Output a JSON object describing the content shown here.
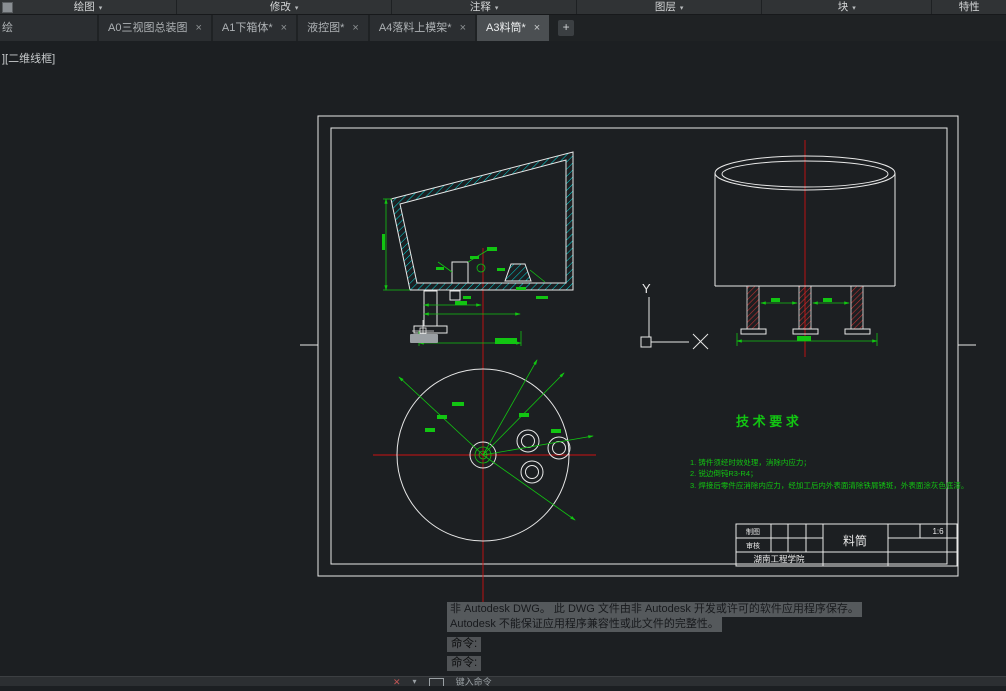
{
  "ribbon": {
    "arrow": "▾",
    "panels": [
      {
        "label": "绘图"
      },
      {
        "label": "修改"
      },
      {
        "label": "注释"
      },
      {
        "label": "图层"
      },
      {
        "label": "块"
      },
      {
        "label": "特性"
      }
    ]
  },
  "tabs": {
    "close_glyph": "×",
    "new_glyph": "+",
    "items": [
      {
        "label": "绘"
      },
      {
        "label": "A0三视图总装图"
      },
      {
        "label": "A1下箱体*"
      },
      {
        "label": "液控图*"
      },
      {
        "label": "A4落料上模架*"
      },
      {
        "label": "A3料筒*"
      }
    ],
    "active": "A3料筒*"
  },
  "viewport_label": "][二维线框]",
  "drawing": {
    "ucs_y": "Y",
    "tech_title": "技 术 要 求",
    "req1": "1. 铸件须经时效处理，消除内应力；",
    "req2": "2. 锐边倒钝R3-R4；",
    "req3": "3. 焊接后零件应消除内应力，经加工后内外表面清除铁屑锈斑，外表面涂灰色底漆。",
    "titleblock": {
      "drafter": "制图",
      "checker": "审核",
      "part_name": "料筒",
      "scale": "1:6",
      "org": "湖南工程学院"
    }
  },
  "messages": {
    "warning_line1": "非 Autodesk DWG。  此 DWG 文件由非 Autodesk 开发或许可的软件应用程序保存。",
    "warning_line2": "Autodesk 不能保证应用程序兼容性或此文件的完整性。",
    "prompt1": "命令:",
    "prompt2": "命令:"
  },
  "statusbar": {
    "close_glyph": "✕",
    "dropdown_glyph": "▾",
    "prompt": "键入命令"
  },
  "colors": {
    "dimension_green": "#12c512",
    "centerline_red": "#cc1111",
    "hatch_cyan": "#00dcdc",
    "line_white": "#e8e8e8",
    "background": "#1c1f22"
  }
}
